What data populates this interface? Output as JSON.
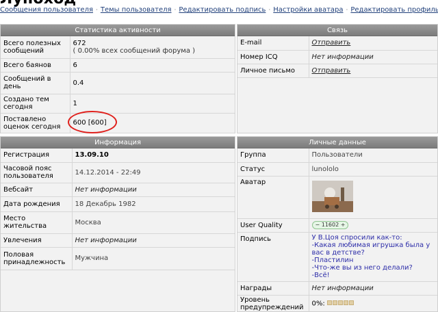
{
  "page_title": "Луноход",
  "nav": [
    "Сообщения пользователя",
    "Темы пользователя",
    "Редактировать подпись",
    "Настройки аватара",
    "Редактировать профиль"
  ],
  "nav_sep": "·",
  "activity": {
    "title": "Статистика активности",
    "rows": [
      {
        "label": "Всего полезных сообщений",
        "value": "672",
        "note": "( 0.00% всех сообщений форума )"
      },
      {
        "label": "Всего баянов",
        "value": "6"
      },
      {
        "label": "Сообщений в день",
        "value": "0.4"
      },
      {
        "label": "Создано тем сегодня",
        "value": "1"
      },
      {
        "label": "Поставлено оценок сегодня",
        "value": "600 [600]"
      }
    ]
  },
  "contact": {
    "title": "Связь",
    "rows": [
      {
        "label": "E-mail",
        "value": "Отправить"
      },
      {
        "label": "Номер ICQ",
        "value": "Нет информации"
      },
      {
        "label": "Личное письмо",
        "value": "Отправить"
      }
    ]
  },
  "info": {
    "title": "Информация",
    "rows": [
      {
        "label": "Регистрация",
        "value": "13.09.10"
      },
      {
        "label": "Часовой пояс пользователя",
        "value": "14.12.2014 - 22:49"
      },
      {
        "label": "Вебсайт",
        "value": "Нет информации"
      },
      {
        "label": "Дата рождения",
        "value": "18 Декабрь 1982"
      },
      {
        "label": "Место жительства",
        "value": "Москва"
      },
      {
        "label": "Увлечения",
        "value": "Нет информации"
      },
      {
        "label": "Половая принадлежность",
        "value": "Мужчина"
      }
    ]
  },
  "personal": {
    "title": "Личные данные",
    "group_label": "Группа",
    "group": "Пользователи",
    "status_label": "Статус",
    "status": "lunololo",
    "avatar_label": "Аватар",
    "quality_label": "User Quality",
    "quality": "11602",
    "signature_label": "Подпись",
    "signature": [
      "У В.Цоя спросили как-то:",
      "-Какая любимая игрушка была у вас в детстве?",
      "-Пластилин",
      "-Что-же вы из него делали?",
      "-Всё!"
    ],
    "awards_label": "Награды",
    "awards": "Нет информации",
    "warn_label": "Уровень предупреждений",
    "warn": "0%:",
    "warn_level": 0
  },
  "colors": {
    "link": "#1f3f7a",
    "header": "#7c7c7c",
    "circle": "#e0201c",
    "signature": "#2c2ca8"
  }
}
